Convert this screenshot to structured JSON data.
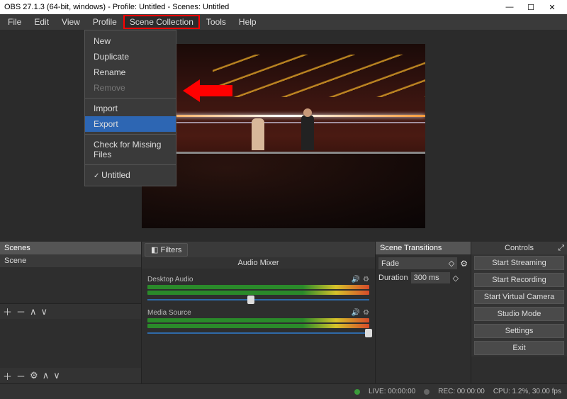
{
  "title": "OBS 27.1.3 (64-bit, windows) - Profile: Untitled - Scenes: Untitled",
  "menubar": [
    "File",
    "Edit",
    "View",
    "Profile",
    "Scene Collection",
    "Tools",
    "Help"
  ],
  "dropdown": {
    "items": [
      "New",
      "Duplicate",
      "Rename",
      "Remove",
      "Import",
      "Export",
      "Check for Missing Files",
      "Untitled"
    ],
    "selected": "Export",
    "disabled": "Remove",
    "checked": "Untitled"
  },
  "scenes": {
    "title": "Scenes",
    "items": [
      "Scene"
    ]
  },
  "mixer": {
    "filters_label": "Filters",
    "title": "Audio Mixer",
    "tracks": [
      {
        "name": "Desktop Audio"
      },
      {
        "name": "Media Source"
      }
    ]
  },
  "transitions": {
    "title": "Scene Transitions",
    "select": "Fade",
    "duration_label": "Duration",
    "duration_value": "300 ms"
  },
  "controls": {
    "title": "Controls",
    "buttons": [
      "Start Streaming",
      "Start Recording",
      "Start Virtual Camera",
      "Studio Mode",
      "Settings",
      "Exit"
    ]
  },
  "status": {
    "live": "LIVE: 00:00:00",
    "rec": "REC: 00:00:00",
    "cpu": "CPU: 1.2%, 30.00 fps"
  },
  "icons": {
    "plus": "＋",
    "minus": "－",
    "up": "∧",
    "down": "∨",
    "gear": "⚙",
    "updown": "◇",
    "spin": "◇",
    "speaker": "🔊",
    "min": "—",
    "max": "☐",
    "close": "✕",
    "expand": "⤢"
  }
}
